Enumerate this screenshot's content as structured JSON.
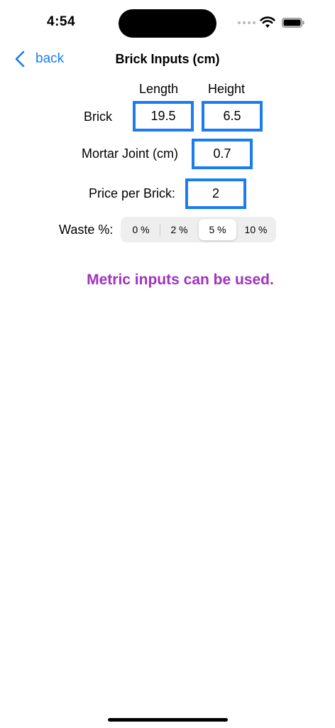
{
  "status": {
    "time": "4:54"
  },
  "nav": {
    "back_label": "back",
    "title": "Brick Inputs (cm)"
  },
  "columns": {
    "length": "Length",
    "height": "Height"
  },
  "brick": {
    "label": "Brick",
    "length": "19.5",
    "height": "6.5"
  },
  "mortar": {
    "label": "Mortar Joint (cm)",
    "value": "0.7"
  },
  "price": {
    "label": "Price per Brick:",
    "value": "2"
  },
  "waste": {
    "label": "Waste %:",
    "options": [
      "0 %",
      "2 %",
      "5 %",
      "10 %"
    ],
    "selected": "5 %"
  },
  "note": {
    "text": "Metric inputs can be used.",
    "color": "#a032c0"
  },
  "accent": "#1a7cf0"
}
